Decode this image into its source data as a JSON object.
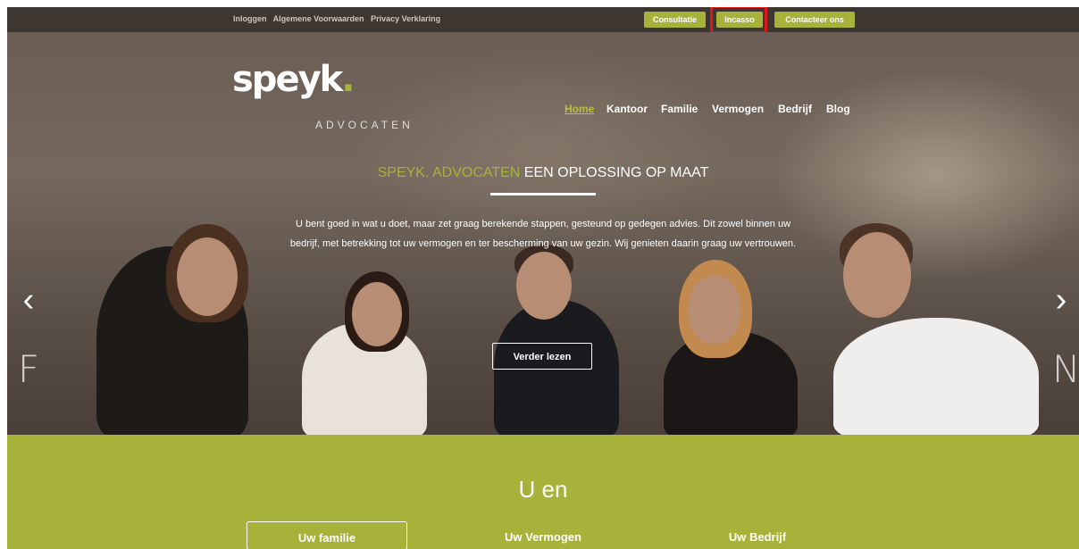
{
  "topbar": {
    "links": [
      "Inloggen",
      "Algemene Voorwaarden",
      "Privacy Verklaring"
    ],
    "buttons": {
      "consultatie": "Consultatie",
      "incasso": "Incasso",
      "contact": "Contacteer ons"
    }
  },
  "brand": {
    "name": "speyk",
    "dot": ".",
    "sub": "ADVOCATEN"
  },
  "nav": {
    "home": "Home",
    "kantoor": "Kantoor",
    "familie": "Familie",
    "vermogen": "Vermogen",
    "bedrijf": "Bedrijf",
    "blog": "Blog"
  },
  "hero": {
    "tagline_green": "SPEYK. ADVOCATEN",
    "tagline_rest": " EEN OPLOSSING OP MAAT",
    "intro": "U bent goed in wat u doet, maar zet graag berekende stappen, gesteund op gedegen advies. Dit zowel binnen uw bedrijf, met betrekking tot uw vermogen en ter bescherming van uw gezin. Wij genieten daarin graag uw vertrouwen.",
    "cta": "Verder lezen",
    "prev_arrow": "‹",
    "next_arrow": "›",
    "prev_letter": "F",
    "next_letter": "N"
  },
  "section": {
    "title": "U en",
    "tabs": {
      "familie": "Uw familie",
      "vermogen": "Uw Vermogen",
      "bedrijf": "Uw Bedrijf"
    }
  },
  "colors": {
    "accent": "#a7b23a",
    "topbar": "#3d3631",
    "highlight": "#e3151b"
  }
}
